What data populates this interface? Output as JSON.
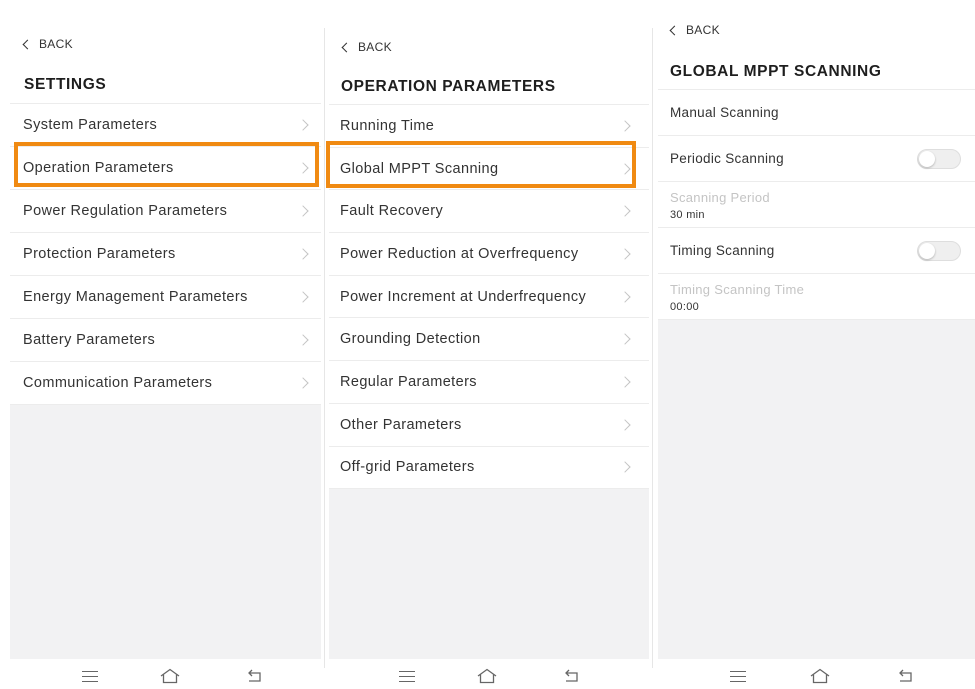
{
  "panels": [
    {
      "back_label": "BACK",
      "title": "SETTINGS",
      "items": [
        {
          "label": "System Parameters"
        },
        {
          "label": "Operation Parameters"
        },
        {
          "label": "Power Regulation Parameters"
        },
        {
          "label": "Protection Parameters"
        },
        {
          "label": "Energy Management Parameters"
        },
        {
          "label": "Battery Parameters"
        },
        {
          "label": "Communication Parameters"
        }
      ],
      "highlighted_item": "Operation Parameters"
    },
    {
      "back_label": "BACK",
      "title": "OPERATION PARAMETERS",
      "items": [
        {
          "label": "Running Time"
        },
        {
          "label": "Global MPPT Scanning"
        },
        {
          "label": "Fault Recovery"
        },
        {
          "label": "Power Reduction at Overfrequency"
        },
        {
          "label": "Power Increment at Underfrequency"
        },
        {
          "label": "Grounding Detection"
        },
        {
          "label": "Regular Parameters"
        },
        {
          "label": "Other Parameters"
        },
        {
          "label": "Off-grid Parameters"
        }
      ],
      "highlighted_item": "Global MPPT Scanning"
    },
    {
      "back_label": "BACK",
      "title": "GLOBAL MPPT SCANNING",
      "items": [
        {
          "label": "Manual Scanning"
        },
        {
          "label": "Periodic Scanning",
          "toggle": "off"
        },
        {
          "label": "Scanning Period",
          "value": "30 min",
          "disabled": true
        },
        {
          "label": "Timing Scanning",
          "toggle": "off"
        },
        {
          "label": "Timing Scanning Time",
          "value": "00:00",
          "disabled": true
        }
      ]
    }
  ],
  "colors": {
    "highlight": "#f08a12",
    "background_fill": "#f2f2f3",
    "disabled_text": "#c4c4c4"
  },
  "navbar_icons": [
    "menu-icon",
    "home-icon",
    "back-arrow-icon"
  ]
}
